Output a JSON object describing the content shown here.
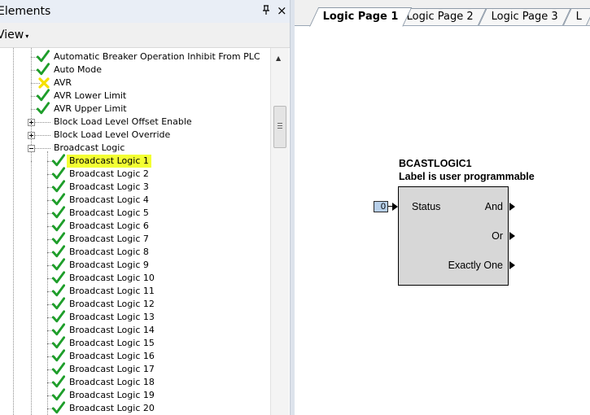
{
  "panel": {
    "title": "Elements",
    "pin_glyph": "ᵖ",
    "close_glyph": "×",
    "view_label": "View",
    "view_caret": "▾",
    "scroll_up_glyph": "▲"
  },
  "tree": {
    "items": [
      {
        "label": "Automatic Breaker Operation Inhibit From PLC",
        "status": "check"
      },
      {
        "label": "Auto Mode",
        "status": "check"
      },
      {
        "label": "AVR",
        "status": "warning"
      },
      {
        "label": "AVR Lower Limit",
        "status": "check"
      },
      {
        "label": "AVR Upper Limit",
        "status": "check"
      },
      {
        "label": "Block Load Level Offset Enable",
        "status": "collapsed"
      },
      {
        "label": "Block Load Level Override",
        "status": "collapsed"
      },
      {
        "label": "Broadcast Logic",
        "status": "expanded"
      },
      {
        "label": "Broadcast Logic 1",
        "status": "check",
        "selected": true
      },
      {
        "label": "Broadcast Logic 2",
        "status": "check"
      },
      {
        "label": "Broadcast Logic 3",
        "status": "check"
      },
      {
        "label": "Broadcast Logic 4",
        "status": "check"
      },
      {
        "label": "Broadcast Logic 5",
        "status": "check"
      },
      {
        "label": "Broadcast Logic 6",
        "status": "check"
      },
      {
        "label": "Broadcast Logic 7",
        "status": "check"
      },
      {
        "label": "Broadcast Logic 8",
        "status": "check"
      },
      {
        "label": "Broadcast Logic 9",
        "status": "check"
      },
      {
        "label": "Broadcast Logic 10",
        "status": "check"
      },
      {
        "label": "Broadcast Logic 11",
        "status": "check"
      },
      {
        "label": "Broadcast Logic 12",
        "status": "check"
      },
      {
        "label": "Broadcast Logic 13",
        "status": "check"
      },
      {
        "label": "Broadcast Logic 14",
        "status": "check"
      },
      {
        "label": "Broadcast Logic 15",
        "status": "check"
      },
      {
        "label": "Broadcast Logic 16",
        "status": "check"
      },
      {
        "label": "Broadcast Logic 17",
        "status": "check"
      },
      {
        "label": "Broadcast Logic 18",
        "status": "check"
      },
      {
        "label": "Broadcast Logic 19",
        "status": "check"
      },
      {
        "label": "Broadcast Logic 20",
        "status": "check"
      }
    ]
  },
  "tabs": [
    {
      "label": "Logic Page 1",
      "active": true
    },
    {
      "label": "Logic Page 2",
      "active": false
    },
    {
      "label": "Logic Page 3",
      "active": false
    },
    {
      "label": "L",
      "active": false
    }
  ],
  "block": {
    "name": "BCASTLOGIC1",
    "label": "Label is user programmable",
    "input_value": "0",
    "input_pin": "Status",
    "outputs": [
      "And",
      "Or",
      "Exactly One"
    ]
  },
  "colors": {
    "check": "#1e9e2a",
    "warning": "#f5e000",
    "selected_highlight": "#f3ff33",
    "block_fill": "#d7d7d7",
    "input_fill": "#b7cfe9"
  },
  "icons": {
    "check": "check-icon",
    "warning": "warning-x-icon",
    "expand": "plus-expander-icon",
    "collapse": "minus-expander-icon"
  }
}
